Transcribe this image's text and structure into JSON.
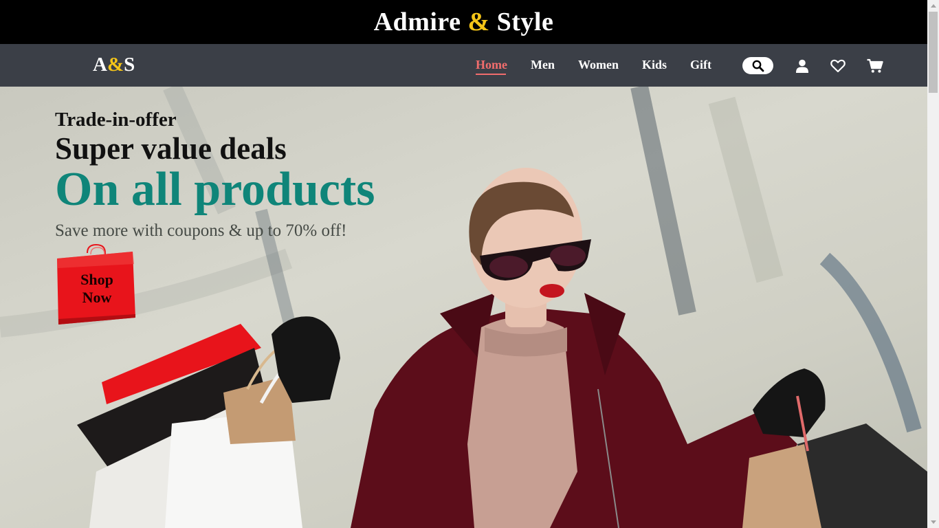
{
  "banner": {
    "title_part1": "Admire ",
    "title_amp": "&",
    "title_part2": " Style"
  },
  "navbar": {
    "logo_part1": "A",
    "logo_amp": "&",
    "logo_part2": "S",
    "links": [
      {
        "label": "Home",
        "active": true
      },
      {
        "label": "Men"
      },
      {
        "label": "Women"
      },
      {
        "label": "Kids"
      },
      {
        "label": "Gift"
      }
    ],
    "icons": [
      "search-icon",
      "user-icon",
      "heart-icon",
      "cart-icon"
    ]
  },
  "hero": {
    "kicker": "Trade-in-offer",
    "headline": "Super value deals",
    "headline_big": "On all products",
    "subtext": "Save more with coupons & up to 70% off!",
    "cta_line1": "Shop",
    "cta_line2": "Now",
    "image": "woman-with-shopping-bags-photo"
  },
  "colors": {
    "accent_gold": "#f5c518",
    "accent_teal": "#0f8579",
    "active_link": "#f26d6d",
    "navbar_bg": "#3b3f47",
    "banner_bg": "#000000",
    "cta_red": "#e8141b"
  }
}
